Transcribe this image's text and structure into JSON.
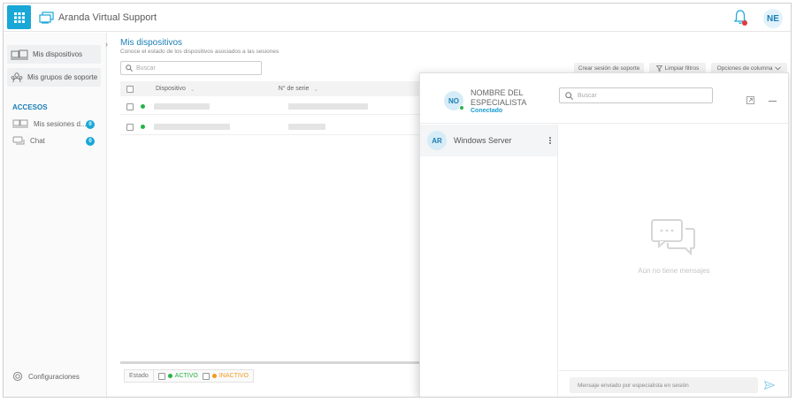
{
  "app": {
    "title": "Aranda Virtual Support",
    "user_initials": "NE"
  },
  "sidebar": {
    "items": [
      {
        "label": "Mis dispositivos",
        "icon": "devices-icon"
      },
      {
        "label": "Mis grupos de soporte",
        "icon": "group-icon"
      }
    ],
    "section_label": "ACCESOS",
    "links": [
      {
        "label": "Mis sesiones d...",
        "count": "0",
        "icon": "sessions-icon"
      },
      {
        "label": "Chat",
        "count": "0",
        "icon": "chat-icon"
      }
    ],
    "config_label": "Configuraciones"
  },
  "main": {
    "title": "Mis dispositivos",
    "subtitle": "Conoce el estado de los dispositivos asociados a las sesiones",
    "search_placeholder": "Buscar",
    "toolbar": {
      "create_session": "Crear sesión de soporte",
      "clear_filters": "Limpiar filtros",
      "column_options": "Opciones de columna"
    },
    "columns": [
      "Dispositivo",
      "N° de serie"
    ],
    "legend": {
      "label": "Estado",
      "active": "ACTIVO",
      "inactive": "INACTIVO"
    },
    "colors": {
      "accent": "#1a7fb5",
      "active": "#26b34a",
      "inactive": "#f39a1f"
    }
  },
  "chat": {
    "specialist_name": "NOMBRE DEL ESPECIALISTA",
    "specialist_initials": "NO",
    "status": "Conectado",
    "search_placeholder": "Buscar",
    "conversations": [
      {
        "initials": "AR",
        "name": "Windows Server"
      }
    ],
    "empty_message": "Aún no tiene mensajes",
    "composer_placeholder": "Mensaje enviado por especialista en sesión"
  }
}
